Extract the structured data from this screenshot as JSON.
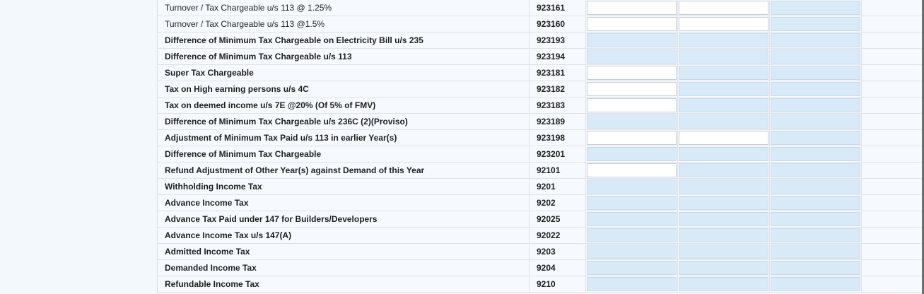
{
  "rows": [
    {
      "label": "Turnover / Tax Chargeable u/s 113 @ 1.25%",
      "code": "923161",
      "bold": false,
      "inputs": [
        "editable",
        "editable",
        "readonly"
      ]
    },
    {
      "label": "Turnover / Tax Chargeable u/s 113 @1.5%",
      "code": "923160",
      "bold": false,
      "inputs": [
        "editable",
        "editable",
        "readonly"
      ]
    },
    {
      "label": "Difference of Minimum Tax Chargeable on Electricity Bill u/s 235",
      "code": "923193",
      "bold": true,
      "inputs": [
        "readonly",
        "readonly",
        "readonly"
      ]
    },
    {
      "label": "Difference of Minimum Tax Chargeable u/s 113",
      "code": "923194",
      "bold": true,
      "inputs": [
        "readonly",
        "readonly",
        "readonly"
      ]
    },
    {
      "label": "Super Tax Chargeable",
      "code": "923181",
      "bold": true,
      "inputs": [
        "editable",
        "readonly",
        "readonly"
      ]
    },
    {
      "label": "Tax on High earning persons u/s 4C",
      "code": "923182",
      "bold": true,
      "inputs": [
        "editable",
        "readonly",
        "readonly"
      ]
    },
    {
      "label": "Tax on deemed income u/s 7E @20% (Of 5% of FMV)",
      "code": "923183",
      "bold": true,
      "inputs": [
        "editable",
        "readonly",
        "readonly"
      ]
    },
    {
      "label": "Difference of Minimum Tax Chargeable u/s 236C (2)(Proviso)",
      "code": "923189",
      "bold": true,
      "inputs": [
        "readonly",
        "readonly",
        "readonly"
      ]
    },
    {
      "label": "Adjustment of Minimum Tax Paid u/s 113 in earlier Year(s)",
      "code": "923198",
      "bold": true,
      "inputs": [
        "editable",
        "editable",
        "readonly"
      ]
    },
    {
      "label": "Difference of Minimum Tax Chargeable",
      "code": "923201",
      "bold": true,
      "inputs": [
        "readonly",
        "readonly",
        "readonly"
      ]
    },
    {
      "label": "Refund Adjustment of Other Year(s) against Demand of this Year",
      "code": "92101",
      "bold": true,
      "inputs": [
        "editable",
        "readonly",
        "readonly"
      ]
    },
    {
      "label": "Withholding Income Tax",
      "code": "9201",
      "bold": true,
      "inputs": [
        "readonly",
        "readonly",
        "readonly"
      ]
    },
    {
      "label": "Advance Income Tax",
      "code": "9202",
      "bold": true,
      "inputs": [
        "readonly",
        "readonly",
        "readonly"
      ]
    },
    {
      "label": "Advance Tax Paid under 147 for Builders/Developers",
      "code": "92025",
      "bold": true,
      "inputs": [
        "readonly",
        "readonly",
        "readonly"
      ]
    },
    {
      "label": "Advance Income Tax u/s 147(A)",
      "code": "92022",
      "bold": true,
      "inputs": [
        "readonly",
        "readonly",
        "readonly"
      ]
    },
    {
      "label": "Admitted Income Tax",
      "code": "9203",
      "bold": true,
      "inputs": [
        "readonly",
        "readonly",
        "readonly"
      ]
    },
    {
      "label": "Demanded Income Tax",
      "code": "9204",
      "bold": true,
      "inputs": [
        "readonly",
        "readonly",
        "readonly"
      ]
    },
    {
      "label": "Refundable Income Tax",
      "code": "9210",
      "bold": true,
      "inputs": [
        "readonly",
        "readonly",
        "readonly"
      ]
    }
  ],
  "colors": {
    "editable": "#ffffff",
    "readonly": "#d8e9f7",
    "row_bg": "#f6fafe"
  }
}
